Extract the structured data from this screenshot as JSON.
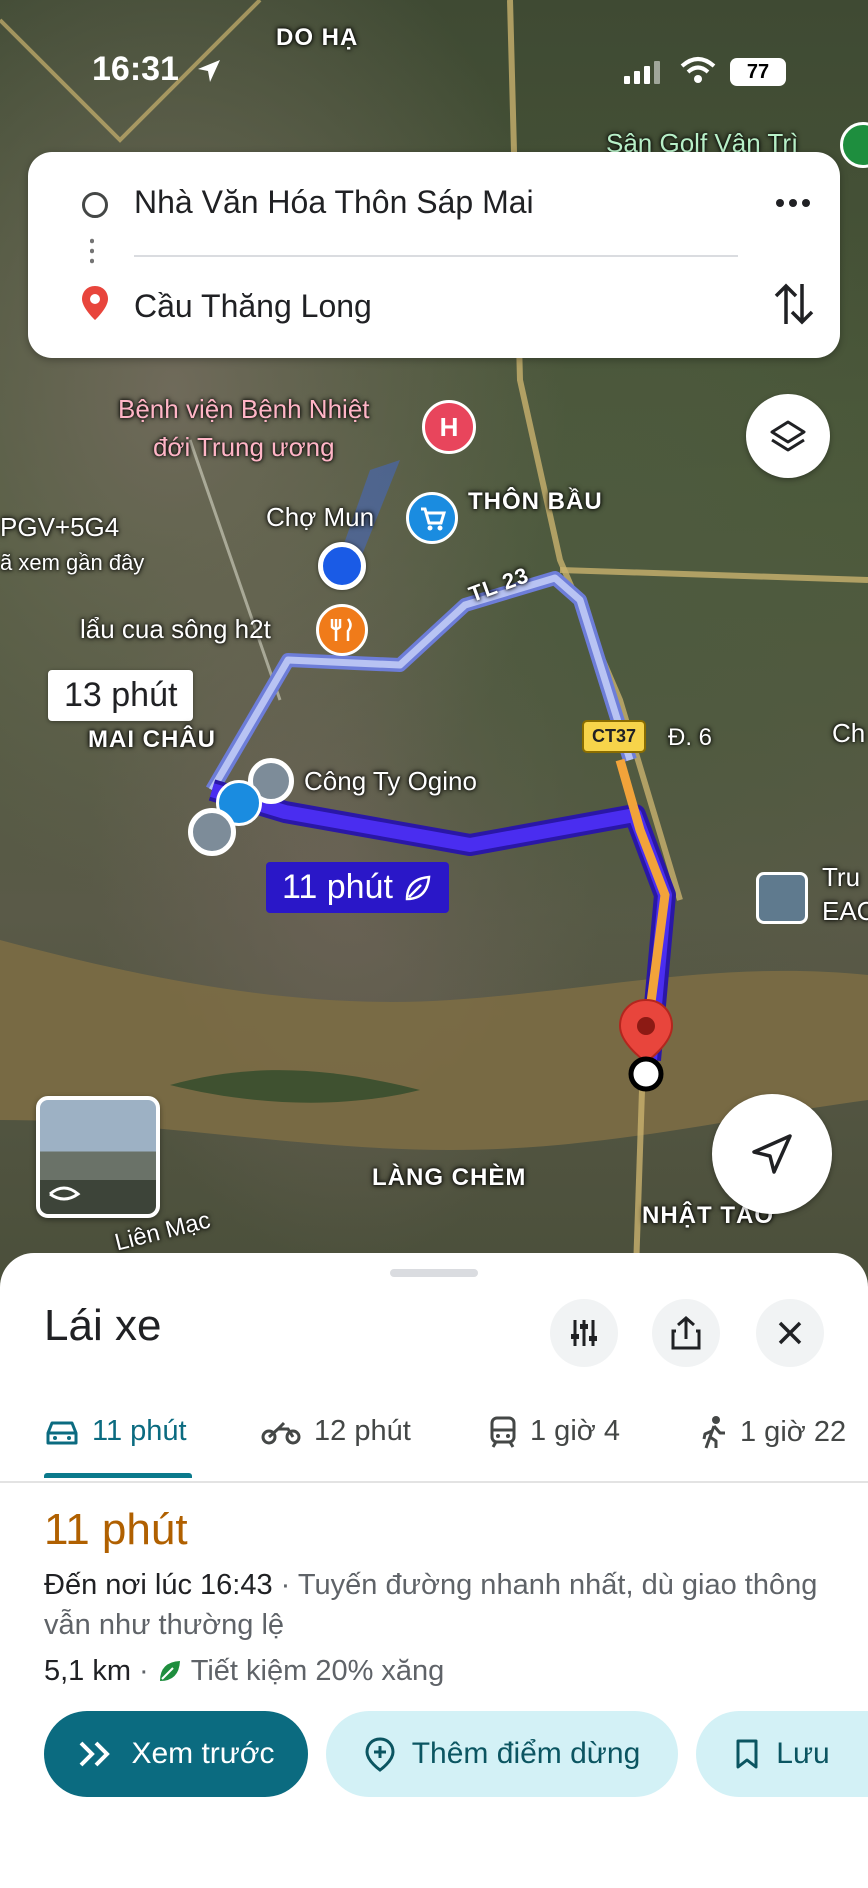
{
  "status_bar": {
    "time": "16:31",
    "battery": "77"
  },
  "map": {
    "labels": {
      "do_ha": "DO HẠ",
      "golf": "Sân Golf Vân Trì",
      "hospital": "Bệnh viện Bệnh Nhiệt\nđới Trung ương",
      "thon_bau": "THÔN BẦU",
      "cho_mun": "Chợ Mun",
      "plus_code": "PGV+5G4",
      "recent": "ã xem gần đây",
      "lau_cua": "lẩu cua sông h2t",
      "tl23": "TL 23",
      "mai_chau": "MAI CHÂU",
      "cong_ty": "Công Ty Ogino",
      "ct37": "CT37",
      "d6": "Đ. 6",
      "ch": "Ch",
      "tru": "Tru",
      "eac": "EAC",
      "lang_chem": "LÀNG CHÈM",
      "lien_mac": "Liên Mạc",
      "nhat_tao": "NHẬT TẢO"
    },
    "route_times": {
      "alternate": "13 phút",
      "primary": "11 phút"
    }
  },
  "directions": {
    "origin": "Nhà Văn Hóa Thôn Sáp Mai",
    "destination": "Cầu Thăng Long"
  },
  "sheet": {
    "title": "Lái xe",
    "modes": [
      {
        "label": "11 phút",
        "icon": "car-icon"
      },
      {
        "label": "12 phút",
        "icon": "motorcycle-icon"
      },
      {
        "label": "1 giờ 4",
        "icon": "train-icon"
      },
      {
        "label": "1 giờ 22",
        "icon": "walking-icon"
      }
    ],
    "eta": "11 phút",
    "arrival": "Đến nơi lúc 16:43",
    "description": " · Tuyến đường nhanh nhất, dù giao thông vẫn như thường lệ",
    "distance": "5,1 km",
    "savings": "Tiết kiệm 20% xăng",
    "buttons": {
      "preview": "Xem trước",
      "add_stop": "Thêm điểm dừng",
      "save": "Lưu"
    }
  },
  "colors": {
    "accent": "#0b6b80",
    "route": "#3d1fd8",
    "eta": "#b06000"
  }
}
